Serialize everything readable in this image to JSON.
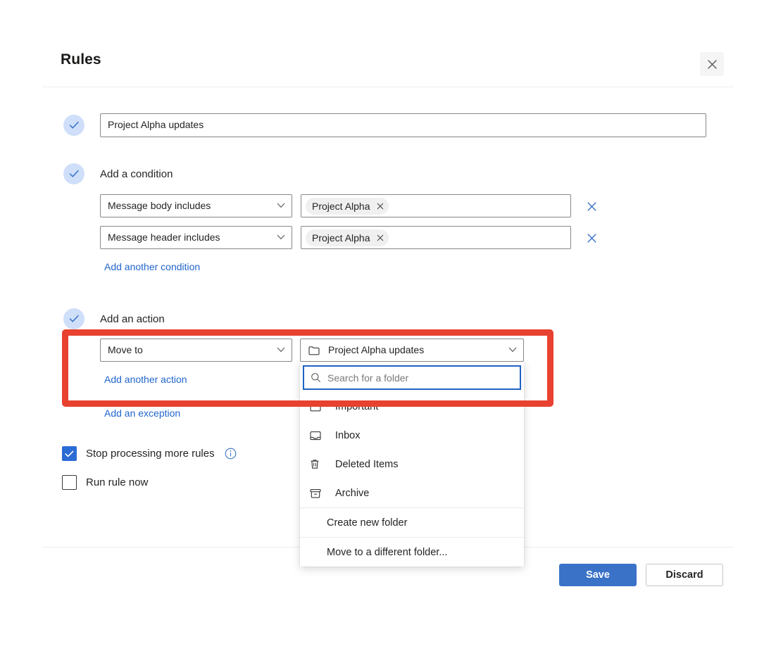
{
  "header": {
    "title": "Rules",
    "close_icon": "close-icon"
  },
  "rule_name": {
    "value": "Project Alpha updates"
  },
  "conditions": {
    "section_label": "Add a condition",
    "rows": [
      {
        "type": "Message body includes",
        "tag": "Project Alpha"
      },
      {
        "type": "Message header includes",
        "tag": "Project Alpha"
      }
    ],
    "add_link": "Add another condition"
  },
  "actions": {
    "section_label": "Add an action",
    "rows": [
      {
        "type": "Move to",
        "value": "Project Alpha updates",
        "value_icon": "folder-icon"
      }
    ],
    "add_link": "Add another action",
    "exception_link": "Add an exception"
  },
  "folder_dropdown": {
    "search_placeholder": "Search for a folder",
    "search_icon": "search-icon",
    "items": [
      {
        "label": "Important",
        "icon": "folder-icon"
      },
      {
        "label": "Inbox",
        "icon": "inbox-icon"
      },
      {
        "label": "Deleted Items",
        "icon": "trash-icon"
      },
      {
        "label": "Archive",
        "icon": "archive-icon"
      }
    ],
    "create_folder": "Create new folder",
    "move_different": "Move to a different folder..."
  },
  "options": {
    "stop_processing": {
      "label": "Stop processing more rules",
      "checked": true,
      "info_icon": "info-icon"
    },
    "run_now": {
      "label": "Run rule now",
      "checked": false
    }
  },
  "footer": {
    "save_label": "Save",
    "discard_label": "Discard"
  },
  "colors": {
    "accent_blue": "#3a72c8",
    "link_blue": "#2266cc",
    "focus_blue": "#1f62c4",
    "annotation_red": "#e8412f",
    "check_circle_bg": "#cfdffa"
  }
}
